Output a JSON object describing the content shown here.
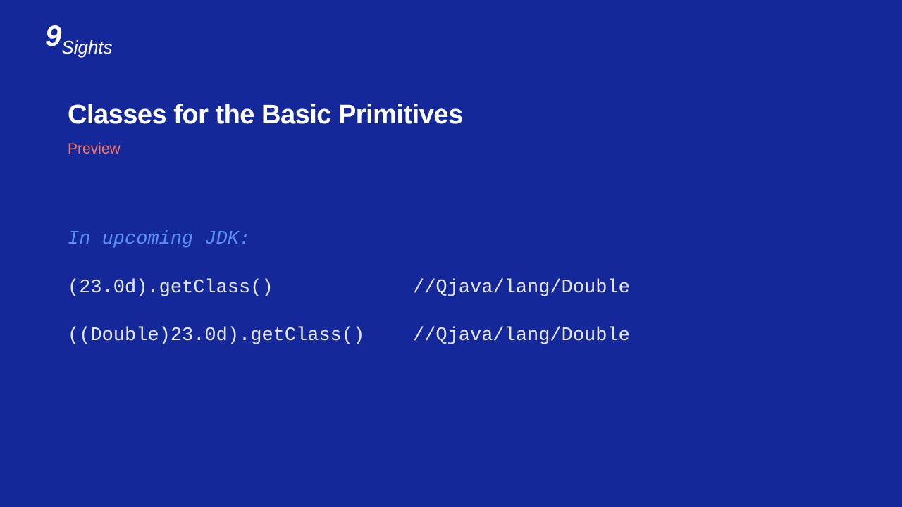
{
  "logo": {
    "nine": "9",
    "text": "Sights"
  },
  "title": "Classes for the Basic Primitives",
  "tag": "Preview",
  "code": {
    "lead_comment": "In upcoming JDK:",
    "rows": [
      {
        "expr": "(23.0d).getClass()",
        "comment": "//Qjava/lang/Double"
      },
      {
        "expr": "((Double)23.0d).getClass()",
        "comment": "//Qjava/lang/Double"
      }
    ]
  }
}
